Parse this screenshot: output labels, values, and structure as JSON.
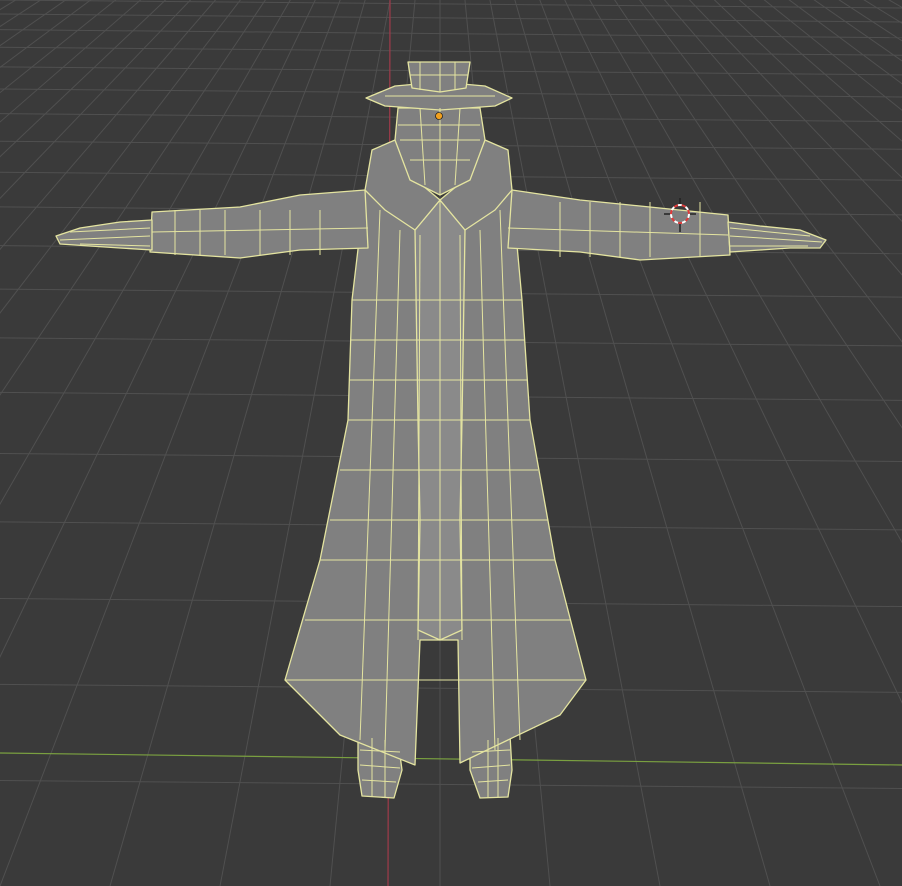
{
  "app": {
    "mode": "edit-mode",
    "view": "perspective"
  },
  "viewport": {
    "background": "#3a3a3a",
    "grid_color": "#505050",
    "x_axis_color": "#7aa040",
    "z_axis_color": "#a03a4a"
  },
  "mesh": {
    "object": "character",
    "pose": "T-pose",
    "face_color": "#808080",
    "wire_color": "#e4e4a0",
    "elements": [
      "hat",
      "head",
      "collar",
      "arms",
      "hands",
      "coat",
      "legs",
      "feet"
    ]
  },
  "cursor_3d": {
    "color": "#e03a3a"
  },
  "origin": {
    "color": "#f0a020"
  }
}
